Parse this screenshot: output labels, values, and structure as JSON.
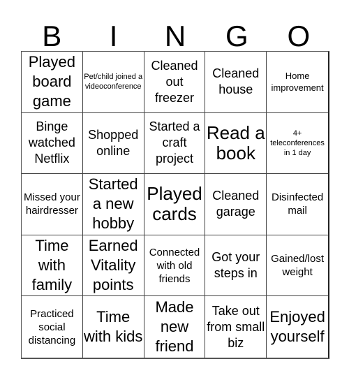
{
  "header": {
    "letters": [
      "B",
      "I",
      "N",
      "G",
      "O"
    ]
  },
  "cells": [
    {
      "text": "Played board game",
      "size": "l"
    },
    {
      "text": "Pet/child joined a videoconference",
      "size": "xxs"
    },
    {
      "text": "Cleaned out freezer",
      "size": "m"
    },
    {
      "text": "Cleaned house",
      "size": "m"
    },
    {
      "text": "Home improvement",
      "size": "xs"
    },
    {
      "text": "Binge watched Netflix",
      "size": "m"
    },
    {
      "text": "Shopped online",
      "size": "m"
    },
    {
      "text": "Started a craft project",
      "size": "m"
    },
    {
      "text": "Read a book",
      "size": "xl"
    },
    {
      "text": "4+ teleconferences in 1 day",
      "size": "xxs"
    },
    {
      "text": "Missed your hairdresser",
      "size": "s"
    },
    {
      "text": "Started a new hobby",
      "size": "l"
    },
    {
      "text": "Played cards",
      "size": "xl"
    },
    {
      "text": "Cleaned garage",
      "size": "m"
    },
    {
      "text": "Disinfected mail",
      "size": "s"
    },
    {
      "text": "Time with family",
      "size": "l"
    },
    {
      "text": "Earned Vitality points",
      "size": "l"
    },
    {
      "text": "Connected with old friends",
      "size": "s"
    },
    {
      "text": "Got your steps in",
      "size": "m"
    },
    {
      "text": "Gained/lost weight",
      "size": "s"
    },
    {
      "text": "Practiced social distancing",
      "size": "s"
    },
    {
      "text": "Time with kids",
      "size": "l"
    },
    {
      "text": "Made new friend",
      "size": "l"
    },
    {
      "text": "Take out from small biz",
      "size": "m"
    },
    {
      "text": "Enjoyed yourself",
      "size": "l"
    }
  ]
}
